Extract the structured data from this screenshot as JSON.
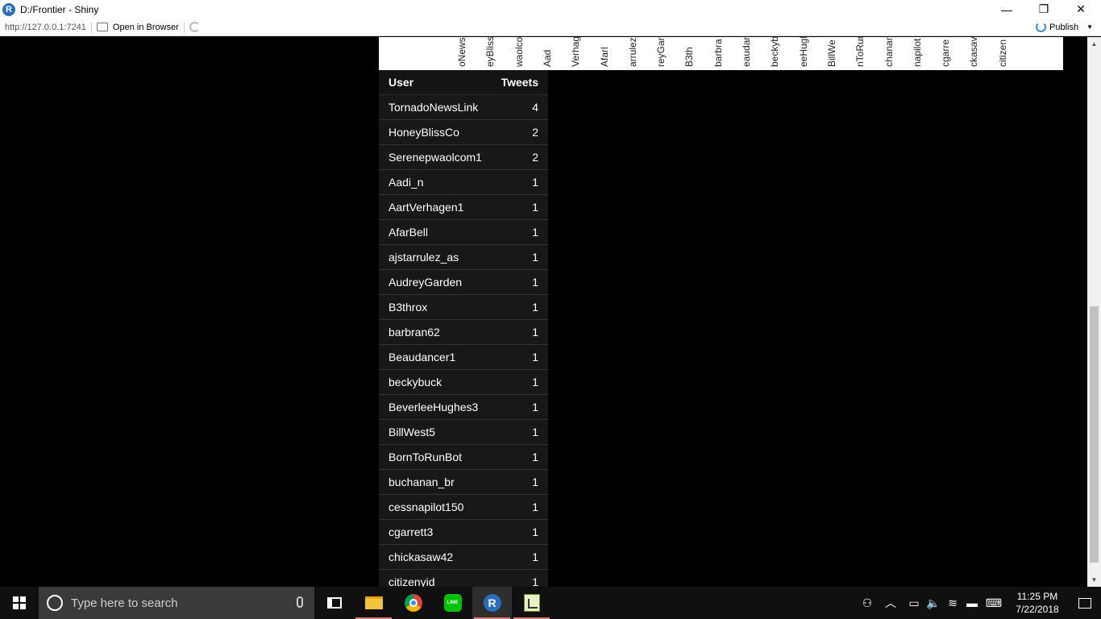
{
  "window": {
    "title": "D:/Frontier - Shiny",
    "app_icon": "r-logo-icon",
    "minimize": "—",
    "restore": "❐",
    "close": "✕"
  },
  "toolbar": {
    "url": "http://127.0.0.1:7241",
    "open_in_browser": "Open in Browser",
    "publish": "Publish"
  },
  "chart_strip": {
    "tick_labels": [
      "oNewsL",
      "eyBliss",
      "waolco",
      "Aad",
      "Verhag",
      "Afarl",
      "arrulez_",
      "reyGarc",
      "B3th",
      "barbra",
      "eaudanc",
      "beckybu",
      "eeHugh",
      "BillWe",
      "nToRun",
      "chanan",
      "napilot",
      "cgarre",
      "ckasav",
      "citizen"
    ]
  },
  "table": {
    "columns": [
      "User",
      "Tweets"
    ],
    "rows": [
      [
        "TornadoNewsLink",
        "4"
      ],
      [
        "HoneyBlissCo",
        "2"
      ],
      [
        "Serenepwaolcom1",
        "2"
      ],
      [
        "Aadi_n",
        "1"
      ],
      [
        "AartVerhagen1",
        "1"
      ],
      [
        "AfarBell",
        "1"
      ],
      [
        "ajstarrulez_as",
        "1"
      ],
      [
        "AudreyGarden",
        "1"
      ],
      [
        "B3throx",
        "1"
      ],
      [
        "barbran62",
        "1"
      ],
      [
        "Beaudancer1",
        "1"
      ],
      [
        "beckybuck",
        "1"
      ],
      [
        "BeverleeHughes3",
        "1"
      ],
      [
        "BillWest5",
        "1"
      ],
      [
        "BornToRunBot",
        "1"
      ],
      [
        "buchanan_br",
        "1"
      ],
      [
        "cessnapilot150",
        "1"
      ],
      [
        "cgarrett3",
        "1"
      ],
      [
        "chickasaw42",
        "1"
      ],
      [
        "citizenyid",
        "1"
      ]
    ]
  },
  "taskbar": {
    "search_placeholder": "Type here to search",
    "apps": [
      "task-view-icon",
      "file-explorer-icon",
      "chrome-icon",
      "line-icon",
      "rstudio-icon",
      "spreadsheet-chart-icon"
    ],
    "line_label": "LINE",
    "r_label": "R",
    "clock_time": "11:25 PM",
    "clock_date": "7/22/2018"
  }
}
